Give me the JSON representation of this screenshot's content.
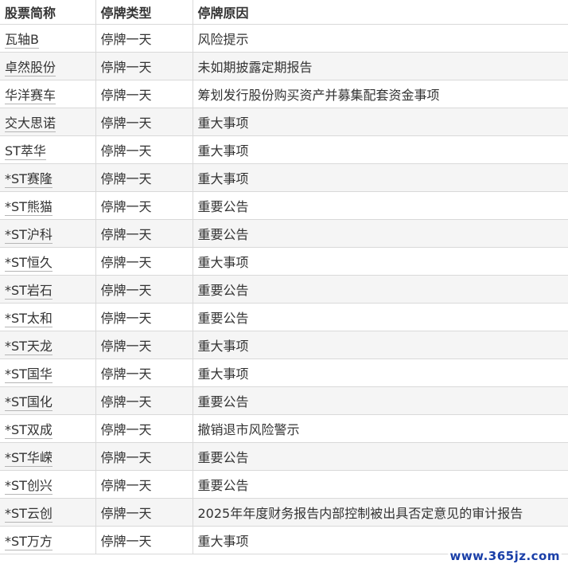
{
  "table": {
    "headers": [
      "股票简称",
      "停牌类型",
      "停牌原因"
    ],
    "rows": [
      {
        "name": "瓦轴B",
        "type": "停牌一天",
        "reason": "风险提示"
      },
      {
        "name": "卓然股份",
        "type": "停牌一天",
        "reason": "未如期披露定期报告"
      },
      {
        "name": "华洋赛车",
        "type": "停牌一天",
        "reason": "筹划发行股份购买资产并募集配套资金事项"
      },
      {
        "name": "交大思诺",
        "type": "停牌一天",
        "reason": "重大事项"
      },
      {
        "name": "ST萃华",
        "type": "停牌一天",
        "reason": "重大事项"
      },
      {
        "name": "*ST赛隆",
        "type": "停牌一天",
        "reason": "重大事项"
      },
      {
        "name": "*ST熊猫",
        "type": "停牌一天",
        "reason": "重要公告"
      },
      {
        "name": "*ST沪科",
        "type": "停牌一天",
        "reason": "重要公告"
      },
      {
        "name": "*ST恒久",
        "type": "停牌一天",
        "reason": "重大事项"
      },
      {
        "name": "*ST岩石",
        "type": "停牌一天",
        "reason": "重要公告"
      },
      {
        "name": "*ST太和",
        "type": "停牌一天",
        "reason": "重要公告"
      },
      {
        "name": "*ST天龙",
        "type": "停牌一天",
        "reason": "重大事项"
      },
      {
        "name": "*ST国华",
        "type": "停牌一天",
        "reason": "重大事项"
      },
      {
        "name": "*ST国化",
        "type": "停牌一天",
        "reason": "重要公告"
      },
      {
        "name": "*ST双成",
        "type": "停牌一天",
        "reason": "撤销退市风险警示"
      },
      {
        "name": "*ST华嵘",
        "type": "停牌一天",
        "reason": "重要公告"
      },
      {
        "name": "*ST创兴",
        "type": "停牌一天",
        "reason": "重要公告"
      },
      {
        "name": "*ST云创",
        "type": "停牌一天",
        "reason": "2025年年度财务报告内部控制被出具否定意见的审计报告"
      },
      {
        "name": "*ST万方",
        "type": "停牌一天",
        "reason": "重大事项"
      }
    ]
  },
  "watermark": "www.365jz.com"
}
